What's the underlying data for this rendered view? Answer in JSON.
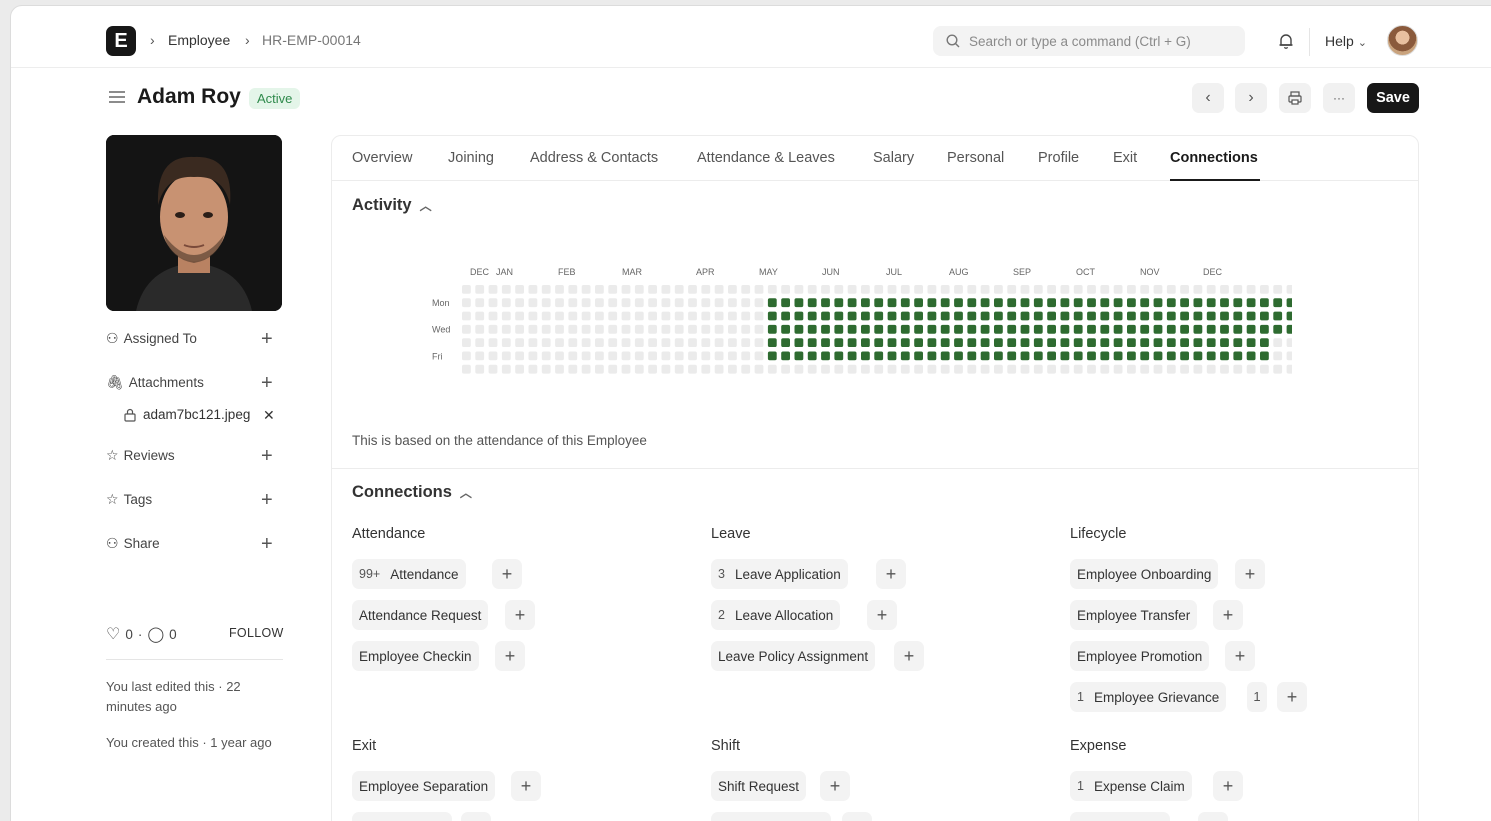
{
  "navbar": {
    "logo": "E",
    "breadcrumb": [
      "Employee",
      "HR-EMP-00014"
    ],
    "search_placeholder": "Search or type a command (Ctrl + G)",
    "help_label": "Help"
  },
  "header": {
    "title": "Adam Roy",
    "status": "Active",
    "save_label": "Save",
    "more_label": "···"
  },
  "sidebar": {
    "assigned_to": "Assigned To",
    "attachments": "Attachments",
    "attachment_file": "adam7bc121.jpeg",
    "reviews": "Reviews",
    "tags": "Tags",
    "share": "Share",
    "likes": "0",
    "comments": "0",
    "follow": "FOLLOW",
    "last_edited": "You last edited this · 22 minutes ago",
    "created": "You created this · 1 year ago"
  },
  "tabs": [
    "Overview",
    "Joining",
    "Address & Contacts",
    "Attendance & Leaves",
    "Salary",
    "Personal",
    "Profile",
    "Exit",
    "Connections"
  ],
  "active_tab": "Connections",
  "activity": {
    "title": "Activity",
    "months": [
      "DEC",
      "JAN",
      "FEB",
      "MAR",
      "APR",
      "MAY",
      "JUN",
      "JUL",
      "AUG",
      "SEP",
      "OCT",
      "NOV",
      "DEC"
    ],
    "day_labels": [
      "Mon",
      "Wed",
      "Fri"
    ],
    "note": "This is based on the attendance of this Employee",
    "color_active": "#2e6b30",
    "color_empty": "#ebebeb"
  },
  "connections": {
    "title": "Connections",
    "attendance": {
      "title": "Attendance",
      "items": [
        {
          "count": "99+",
          "label": "Attendance"
        },
        {
          "count": "",
          "label": "Attendance Request"
        },
        {
          "count": "",
          "label": "Employee Checkin"
        }
      ]
    },
    "leave": {
      "title": "Leave",
      "items": [
        {
          "count": "3",
          "label": "Leave Application"
        },
        {
          "count": "2",
          "label": "Leave Allocation"
        },
        {
          "count": "",
          "label": "Leave Policy Assignment"
        }
      ]
    },
    "lifecycle": {
      "title": "Lifecycle",
      "items": [
        {
          "count": "",
          "label": "Employee Onboarding"
        },
        {
          "count": "",
          "label": "Employee Transfer"
        },
        {
          "count": "",
          "label": "Employee Promotion"
        },
        {
          "count": "1",
          "label": "Employee Grievance",
          "extra": "1"
        }
      ]
    },
    "exit": {
      "title": "Exit",
      "items": [
        {
          "count": "",
          "label": "Employee Separation"
        }
      ]
    },
    "shift": {
      "title": "Shift",
      "items": [
        {
          "count": "",
          "label": "Shift Request"
        }
      ]
    },
    "expense": {
      "title": "Expense",
      "items": [
        {
          "count": "1",
          "label": "Expense Claim"
        }
      ]
    }
  }
}
